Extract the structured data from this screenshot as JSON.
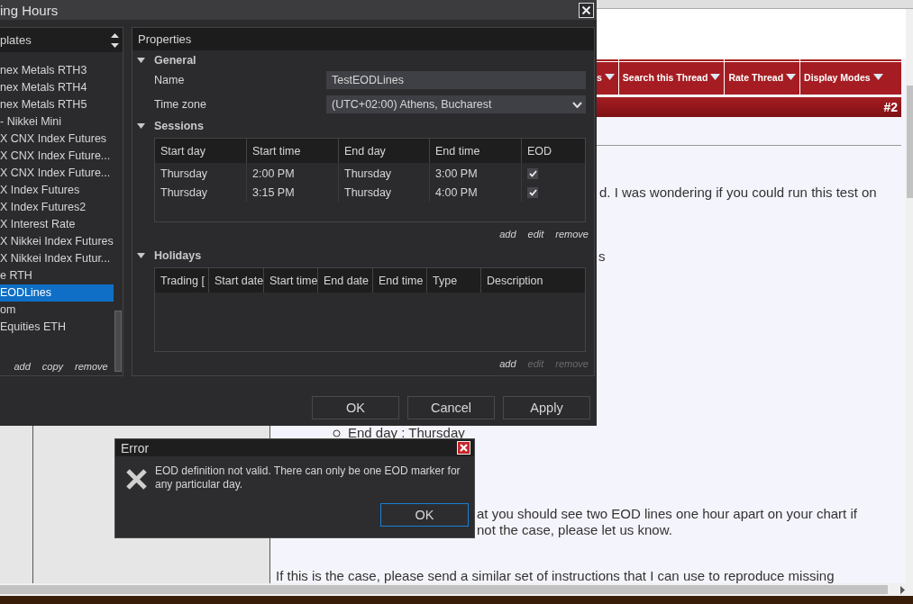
{
  "web_page": {
    "nav": [
      {
        "label": "s"
      },
      {
        "label": "Search this Thread"
      },
      {
        "label": "Rate Thread"
      },
      {
        "label": "Display Modes"
      }
    ],
    "post_number": "#2",
    "lines": [
      {
        "kind": "paragraph",
        "text": "d. I was wondering if you could run this test on"
      },
      {
        "kind": "paragraph",
        "text": "s"
      },
      {
        "kind": "bullet",
        "text": "End day : Thursday"
      },
      {
        "kind": "paragraph",
        "text": "at you should see two EOD lines one hour apart on your chart if"
      },
      {
        "kind": "paragraph",
        "text": "not the case, please let us know."
      },
      {
        "kind": "paragraph",
        "text": "If this is the case, please send a similar set of instructions that I can use to reproduce missing"
      }
    ]
  },
  "dialog": {
    "title": "ing Hours",
    "templates": {
      "header": "plates",
      "items": [
        {
          "label": "nex Metals RTH3",
          "selected": false
        },
        {
          "label": "nex Metals RTH4",
          "selected": false
        },
        {
          "label": "nex Metals RTH5",
          "selected": false
        },
        {
          "label": "- Nikkei Mini",
          "selected": false
        },
        {
          "label": "X CNX Index Futures",
          "selected": false
        },
        {
          "label": "X CNX Index Future...",
          "selected": false
        },
        {
          "label": "X CNX Index Future...",
          "selected": false
        },
        {
          "label": "X Index Futures",
          "selected": false
        },
        {
          "label": "X Index Futures2",
          "selected": false
        },
        {
          "label": "X Interest Rate",
          "selected": false
        },
        {
          "label": "X Nikkei Index Futures",
          "selected": false
        },
        {
          "label": "X Nikkei Index Futur...",
          "selected": false
        },
        {
          "label": "e RTH",
          "selected": false
        },
        {
          "label": "EODLines",
          "selected": true
        },
        {
          "label": "om",
          "selected": false
        },
        {
          "label": "Equities ETH",
          "selected": false
        }
      ],
      "actions": [
        "add",
        "copy",
        "remove"
      ]
    },
    "properties": {
      "title": "Properties",
      "general": {
        "heading": "General",
        "expanded": true,
        "fields": [
          {
            "label": "Name",
            "kind": "text",
            "value": "TestEODLines"
          },
          {
            "label": "Time zone",
            "kind": "select",
            "value": "(UTC+02:00) Athens, Bucharest"
          }
        ]
      },
      "sessions": {
        "heading": "Sessions",
        "expanded": true,
        "columns": [
          "Start day",
          "Start time",
          "End day",
          "End time",
          "EOD"
        ],
        "rows": [
          {
            "start_day": "Thursday",
            "start_time": "2:00 PM",
            "end_day": "Thursday",
            "end_time": "3:00 PM",
            "eod": true
          },
          {
            "start_day": "Thursday",
            "start_time": "3:15 PM",
            "end_day": "Thursday",
            "end_time": "4:00 PM",
            "eod": true
          }
        ],
        "actions": [
          {
            "label": "add",
            "disabled": false
          },
          {
            "label": "edit",
            "disabled": false
          },
          {
            "label": "remove",
            "disabled": false
          }
        ]
      },
      "holidays": {
        "heading": "Holidays",
        "expanded": true,
        "columns": [
          "Trading [",
          "Start date",
          "Start time",
          "End date",
          "End time",
          "Type",
          "Description"
        ],
        "actions": [
          {
            "label": "add",
            "disabled": false
          },
          {
            "label": "edit",
            "disabled": true
          },
          {
            "label": "remove",
            "disabled": true
          }
        ]
      }
    },
    "buttons": [
      "OK",
      "Cancel",
      "Apply"
    ]
  },
  "error_dialog": {
    "title": "Error",
    "message": "EOD definition not valid. There can only be one EOD marker for any particular day.",
    "button": "OK"
  }
}
